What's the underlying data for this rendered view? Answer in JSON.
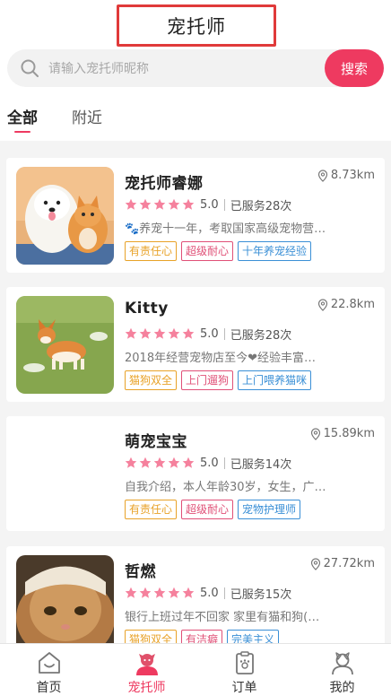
{
  "header": {
    "title": "宠托师"
  },
  "search": {
    "placeholder": "请输入宠托师昵称",
    "button_label": "搜索"
  },
  "tabs": [
    {
      "label": "全部",
      "active": true
    },
    {
      "label": "附近",
      "active": false
    }
  ],
  "colors": {
    "accent": "#ee3a60",
    "star": "#f5819d",
    "tag_orange": "#e8a228",
    "tag_red": "#e05077",
    "tag_blue": "#3a8fd6"
  },
  "sitters": [
    {
      "name": "宠托师睿娜",
      "distance": "8.73km",
      "stars": 5,
      "score": "5.0",
      "served": "已服务28次",
      "description": "🐾养宠十一年，考取国家高级宠物营…",
      "photo": "samoyed and orange cat",
      "tags": [
        {
          "label": "有责任心",
          "color": "orange"
        },
        {
          "label": "超级耐心",
          "color": "red"
        },
        {
          "label": "十年养宠经验",
          "color": "blue"
        }
      ]
    },
    {
      "name": "Kitty",
      "distance": "22.8km",
      "stars": 5,
      "score": "5.0",
      "served": "已服务28次",
      "description": "2018年经营宠物店至今❤经验丰富…",
      "photo": "corgi on grass",
      "tags": [
        {
          "label": "猫狗双全",
          "color": "orange"
        },
        {
          "label": "上门遛狗",
          "color": "red"
        },
        {
          "label": "上门喂养猫咪",
          "color": "blue"
        }
      ]
    },
    {
      "name": "萌宠宝宝",
      "distance": "15.89km",
      "stars": 5,
      "score": "5.0",
      "served": "已服务14次",
      "description": "自我介绍，本人年龄30岁，女生，广…",
      "photo": "",
      "tags": [
        {
          "label": "有责任心",
          "color": "orange"
        },
        {
          "label": "超级耐心",
          "color": "red"
        },
        {
          "label": "宠物护理师",
          "color": "blue"
        }
      ]
    },
    {
      "name": "哲燃",
      "distance": "27.72km",
      "stars": 5,
      "score": "5.0",
      "served": "已服务15次",
      "description": "银行上班过年不回家 家里有猫和狗(…",
      "photo": "tabby cat close-up",
      "tags": [
        {
          "label": "猫狗双全",
          "color": "orange"
        },
        {
          "label": "有洁癖",
          "color": "red"
        },
        {
          "label": "完美主义",
          "color": "blue"
        }
      ]
    }
  ],
  "nav": [
    {
      "label": "首页",
      "icon": "home-icon",
      "active": false
    },
    {
      "label": "宠托师",
      "icon": "sitter-avatar-icon",
      "active": true
    },
    {
      "label": "订单",
      "icon": "order-clipboard-icon",
      "active": false
    },
    {
      "label": "我的",
      "icon": "profile-icon",
      "active": false
    }
  ]
}
